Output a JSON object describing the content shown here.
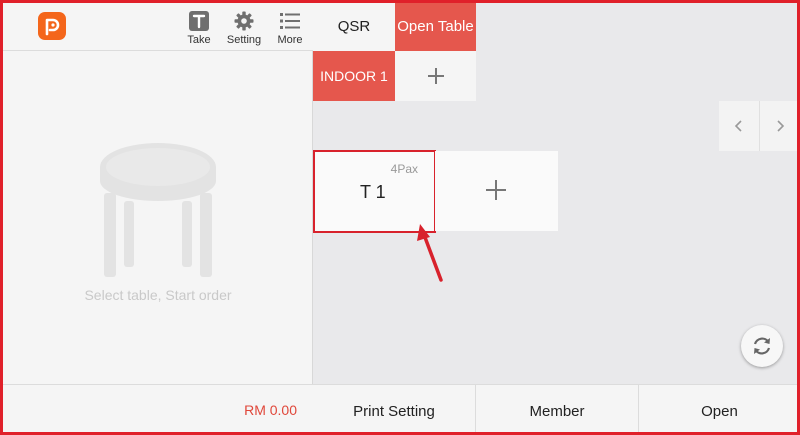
{
  "toolbar": {
    "take_label": "Take",
    "setting_label": "Setting",
    "more_label": "More"
  },
  "icons": {
    "logo": "app-logo-icon",
    "take": "take-icon",
    "setting": "gear-icon",
    "more": "list-icon",
    "add": "plus-icon",
    "prev": "chevron-left-icon",
    "next": "chevron-right-icon",
    "refresh": "refresh-icon"
  },
  "order_panel": {
    "placeholder": "Select table, Start order",
    "total": "RM 0.00"
  },
  "modes": {
    "qsr_label": "QSR",
    "open_table_label": "Open Table",
    "active": "Open Table"
  },
  "areas": {
    "items": [
      {
        "label": "INDOOR 1",
        "selected": true
      }
    ]
  },
  "tables": [
    {
      "name": "T 1",
      "pax": "4Pax",
      "highlighted": true
    }
  ],
  "actions": {
    "print_setting_label": "Print Setting",
    "member_label": "Member",
    "open_label": "Open"
  },
  "colors": {
    "accent": "#e5574d",
    "brand": "#f4661b",
    "annotation": "#d8222c",
    "total_text": "#e0473a"
  }
}
